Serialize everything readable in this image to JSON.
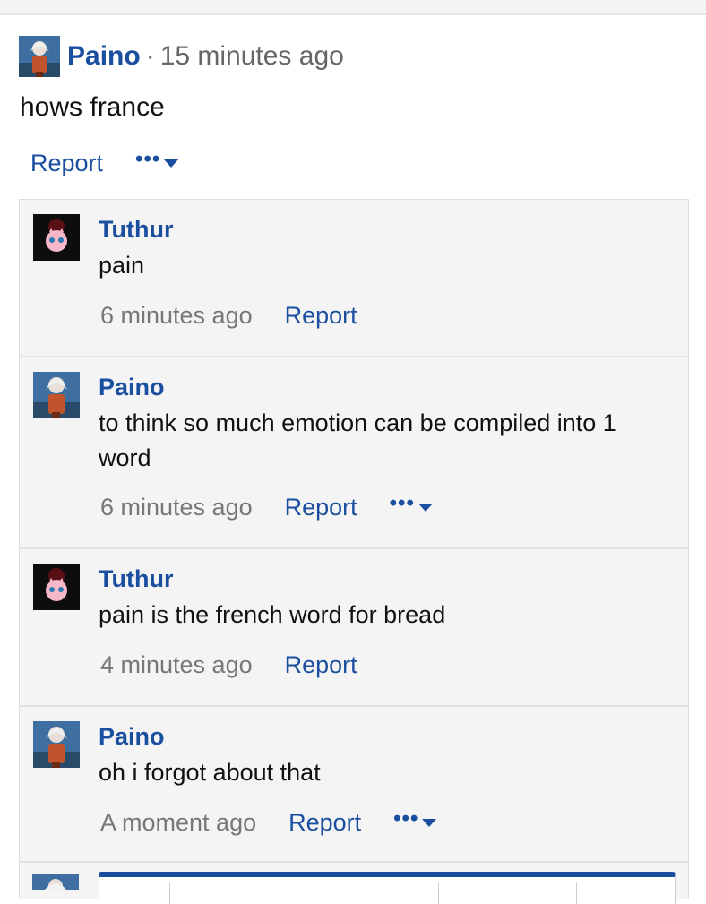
{
  "post": {
    "author": "Paino",
    "separator": "·",
    "time": "15 minutes ago",
    "text": "hows france",
    "report_label": "Report",
    "more_label": "•••"
  },
  "replies": [
    {
      "author": "Tuthur",
      "avatar": "jigglypuff-avatar",
      "text": "pain",
      "time": "6 minutes ago",
      "report_label": "Report"
    },
    {
      "author": "Paino",
      "avatar": "paino-avatar",
      "text": "to think so much emotion can be compiled into 1 word",
      "time": "6 minutes ago",
      "report_label": "Report",
      "more_label": "•••"
    },
    {
      "author": "Tuthur",
      "avatar": "jigglypuff-avatar",
      "text": "pain is the french word for bread",
      "time": "4 minutes ago",
      "report_label": "Report"
    },
    {
      "author": "Paino",
      "avatar": "paino-avatar",
      "text": "oh i forgot about that",
      "time": "A moment ago",
      "report_label": "Report",
      "more_label": "•••"
    }
  ],
  "colors": {
    "link": "#1a4fa0",
    "muted": "#777777",
    "panel": "#f4f4f4"
  }
}
